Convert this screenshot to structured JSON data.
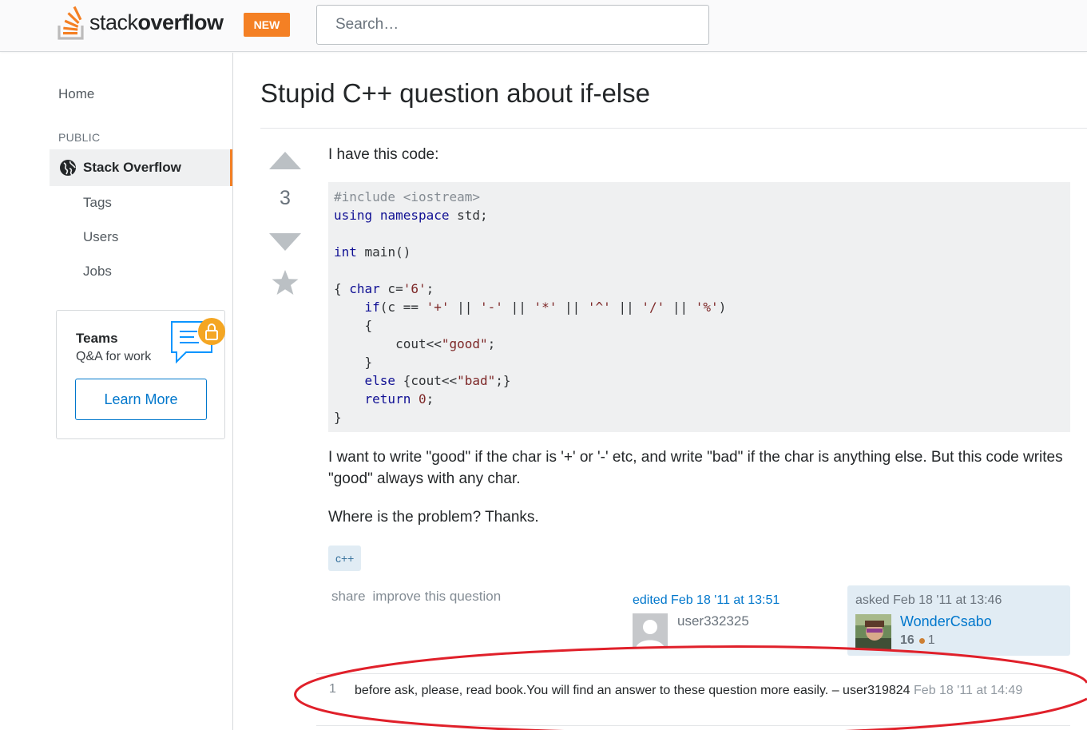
{
  "header": {
    "logo_left": "stack",
    "logo_right": "overflow",
    "new_badge": "NEW",
    "search_placeholder": "Search…"
  },
  "sidebar": {
    "home": "Home",
    "section_label": "PUBLIC",
    "active_item": "Stack Overflow",
    "items": [
      {
        "label": "Tags"
      },
      {
        "label": "Users"
      },
      {
        "label": "Jobs"
      }
    ],
    "teams": {
      "title": "Teams",
      "subtitle": "Q&A for work",
      "button": "Learn More"
    }
  },
  "question": {
    "title": "Stupid C++ question about if-else",
    "score": "3",
    "intro": "I have this code:",
    "code_lines": [
      "#include <iostream>",
      "using namespace std;",
      "",
      "int main()",
      "",
      "{ char c='6';",
      "    if(c == '+' || '-' || '*' || '^' || '/' || '%')",
      "    {",
      "        cout<<\"good\";",
      "    }",
      "    else {cout<<\"bad\";}",
      "    return 0;",
      "}"
    ],
    "paragraph1": "I want to write \"good\" if the char is '+' or '-' etc, and write \"bad\" if the char is anything else. But this code writes \"good\" always with any char.",
    "paragraph2": "Where is the problem? Thanks.",
    "tags": [
      "c++"
    ],
    "menu": {
      "share": "share",
      "improve": "improve this question"
    },
    "edited": {
      "label": "edited Feb 18 '11 at 13:51",
      "user": "user332325"
    },
    "owner": {
      "asked": "asked Feb 18 '11 at 13:46",
      "name": "WonderCsabo",
      "reputation": "16",
      "bronze": "1"
    }
  },
  "comment": {
    "score": "1",
    "text": "before ask, please, read book.You will find an answer to these question more easily. –",
    "user": "user319824",
    "date": "Feb 18 '11 at 14:49"
  },
  "colors": {
    "brand_orange": "#f48024",
    "link_blue": "#0077cc",
    "tag_bg": "#e1ecf4",
    "annotation_red": "#e0202a"
  }
}
